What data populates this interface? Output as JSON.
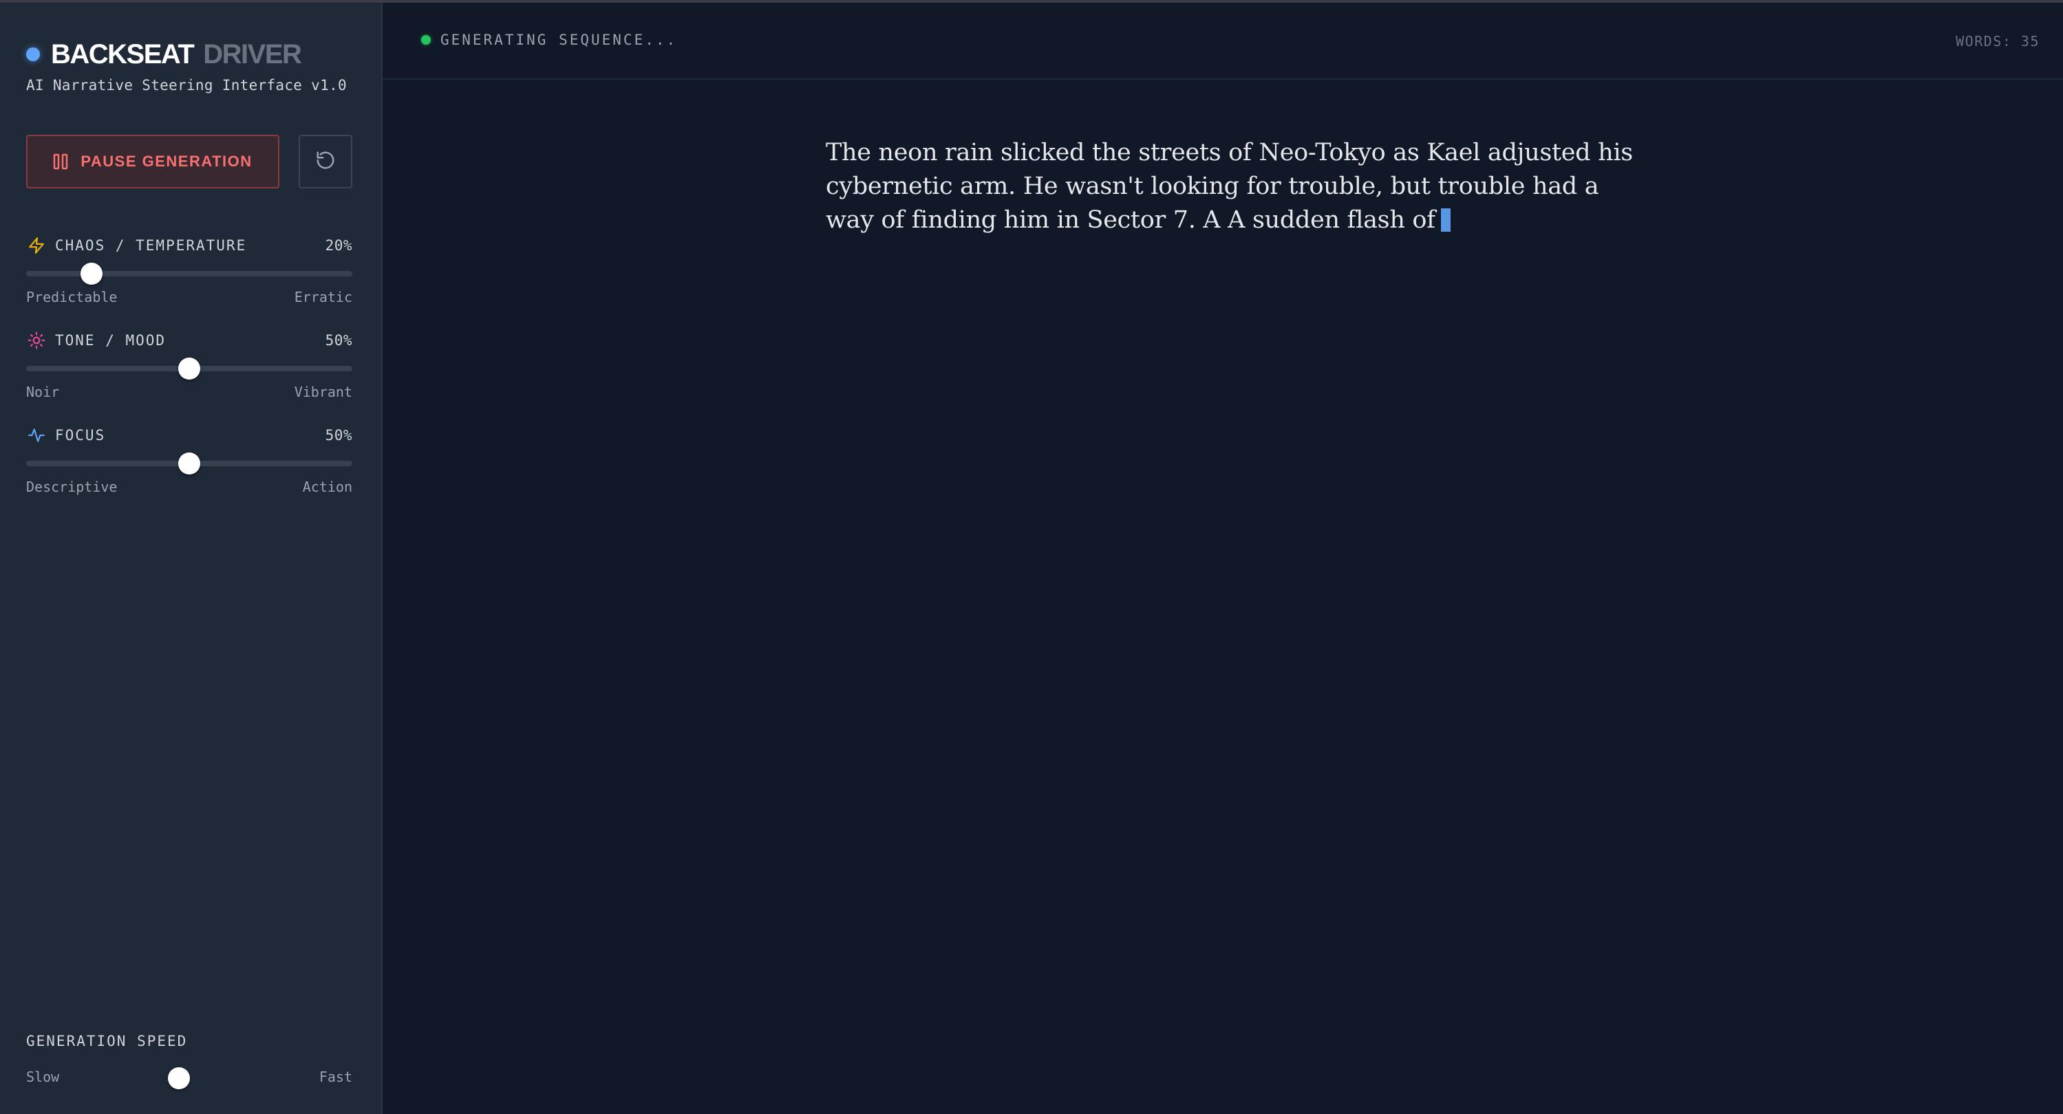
{
  "brand": {
    "name_primary": "BACKSEAT",
    "name_secondary": "DRIVER",
    "subtitle": "AI Narrative Steering Interface v1.0"
  },
  "controls": {
    "pause_label": "PAUSE GENERATION",
    "reset_icon": "reset-icon",
    "sliders": [
      {
        "label": "CHAOS / TEMPERATURE",
        "value_text": "20%",
        "value": 20,
        "min_label": "Predictable",
        "max_label": "Erratic",
        "icon": "lightning-icon",
        "icon_color": "#eab308"
      },
      {
        "label": "TONE / MOOD",
        "value_text": "50%",
        "value": 50,
        "min_label": "Noir",
        "max_label": "Vibrant",
        "icon": "sun-icon",
        "icon_color": "#ec4899"
      },
      {
        "label": "FOCUS",
        "value_text": "50%",
        "value": 50,
        "min_label": "Descriptive",
        "max_label": "Action",
        "icon": "activity-icon",
        "icon_color": "#60a5fa"
      }
    ],
    "speed": {
      "label": "GENERATION SPEED",
      "min_label": "Slow",
      "max_label": "Fast"
    }
  },
  "status": {
    "text": "GENERATING SEQUENCE...",
    "color": "#22c55e"
  },
  "words": "WORDS: 35",
  "story": {
    "text": "The neon rain slicked the streets of Neo-Tokyo as Kael adjusted his cybernetic arm. He wasn't looking for trouble, but trouble had a way of finding him in Sector 7. A A sudden flash of"
  },
  "colors": {
    "accent": "#60a5fa",
    "danger": "#f87171"
  }
}
